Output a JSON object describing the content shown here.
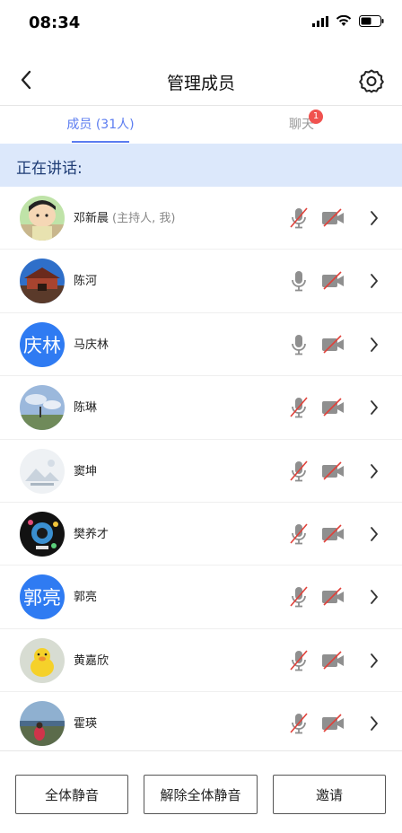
{
  "status": {
    "time": "08:34"
  },
  "header": {
    "title": "管理成员"
  },
  "tabs": {
    "members_label": "成员 (31人)",
    "chat_label": "聊天",
    "chat_badge": "1"
  },
  "speaking": {
    "label": "正在讲话:"
  },
  "members": [
    {
      "name": "邓新晨",
      "role": "(主持人, 我)",
      "avatar": "photo-cartoon",
      "mic": "off",
      "camera": "off"
    },
    {
      "name": "陈河",
      "role": "",
      "avatar": "photo-building",
      "mic": "on",
      "camera": "off"
    },
    {
      "name": "马庆林",
      "role": "",
      "avatar_text": "庆林",
      "mic": "on",
      "camera": "off"
    },
    {
      "name": "陈琳",
      "role": "",
      "avatar": "photo-sky",
      "mic": "off",
      "camera": "off"
    },
    {
      "name": "窦坤",
      "role": "",
      "avatar": "photo-placeholder",
      "mic": "off",
      "camera": "off"
    },
    {
      "name": "樊养才",
      "role": "",
      "avatar": "photo-dark",
      "mic": "off",
      "camera": "off"
    },
    {
      "name": "郭亮",
      "role": "",
      "avatar_text": "郭亮",
      "mic": "off",
      "camera": "off"
    },
    {
      "name": "黄嘉欣",
      "role": "",
      "avatar": "photo-duck",
      "mic": "off",
      "camera": "off"
    },
    {
      "name": "霍瑛",
      "role": "",
      "avatar": "photo-outdoor",
      "mic": "off",
      "camera": "off"
    }
  ],
  "actions": {
    "mute_all": "全体静音",
    "unmute_all": "解除全体静音",
    "invite": "邀请"
  },
  "colors": {
    "accent": "#5b7cf0",
    "speaking_bg": "#dce8fb",
    "muted_red": "#e0413a",
    "avatar_blue": "#2f7bf2"
  }
}
